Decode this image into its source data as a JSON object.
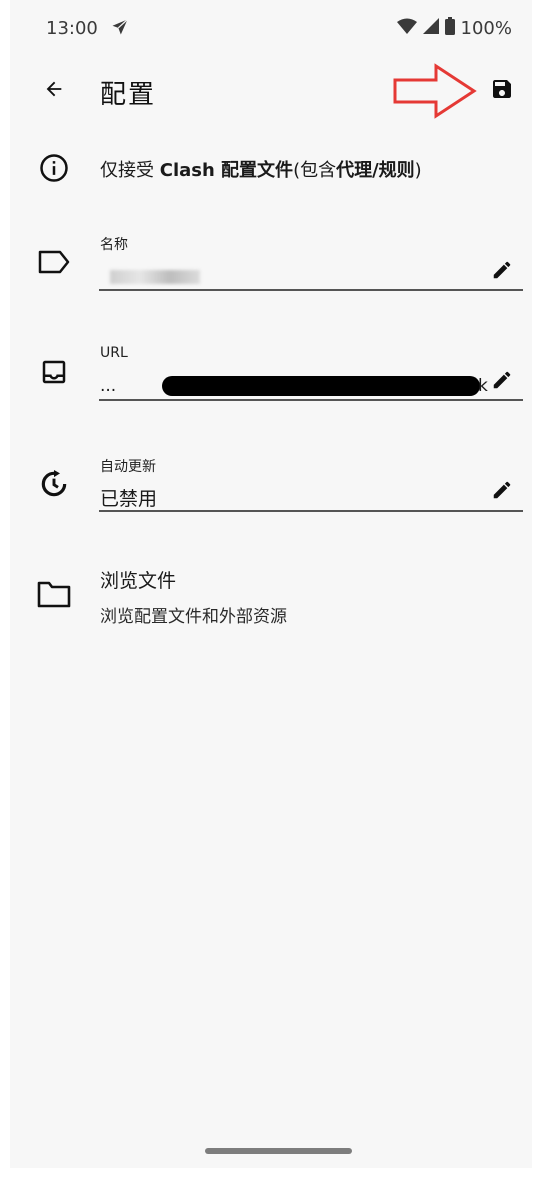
{
  "status_bar": {
    "time": "13:00",
    "battery": "100%",
    "icons": [
      "airplane-icon",
      "wifi-icon",
      "cell-signal-icon",
      "battery-icon"
    ]
  },
  "app_bar": {
    "title": "配置",
    "back_icon": "arrow-left-icon",
    "save_icon": "save-icon"
  },
  "info": {
    "prefix": "仅接受 ",
    "bold1": "Clash 配置文件",
    "mid": "(包含",
    "bold2": "代理",
    "slash": "/",
    "bold3": "规则",
    "suffix": ")"
  },
  "fields": {
    "name": {
      "label": "名称",
      "value": "",
      "redacted": true
    },
    "url": {
      "label": "URL",
      "value_prefix": "...",
      "value_suffix": "k",
      "redacted": true
    },
    "auto_update": {
      "label": "自动更新",
      "value": "已禁用"
    }
  },
  "browse": {
    "title": "浏览文件",
    "subtitle": "浏览配置文件和外部资源"
  },
  "annotation": {
    "color": "#e53935"
  }
}
